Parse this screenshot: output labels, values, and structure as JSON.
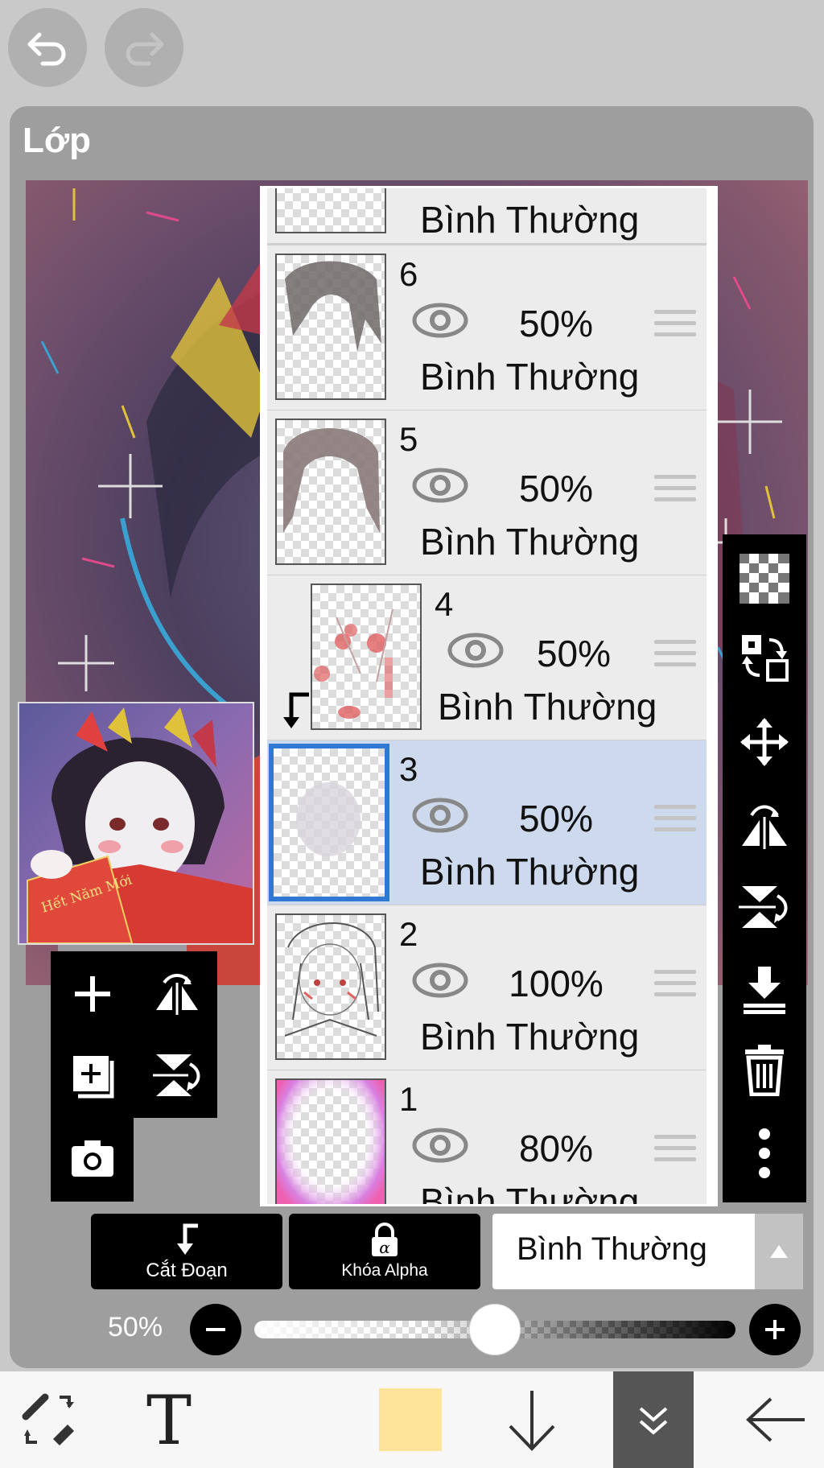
{
  "header": {
    "undo_icon": "undo-icon",
    "redo_icon": "redo-icon"
  },
  "panel": {
    "title": "Lớp"
  },
  "thumbnail_artwork": {
    "text": "Hết Năm Mới"
  },
  "layers": [
    {
      "number": "",
      "opacity": "",
      "mode": "Bình Thường",
      "partial": "top"
    },
    {
      "number": "6",
      "opacity": "50%",
      "mode": "Bình Thường"
    },
    {
      "number": "5",
      "opacity": "50%",
      "mode": "Bình Thường"
    },
    {
      "number": "4",
      "opacity": "50%",
      "mode": "Bình Thường",
      "clipped": true
    },
    {
      "number": "3",
      "opacity": "50%",
      "mode": "Bình Thường",
      "selected": true
    },
    {
      "number": "2",
      "opacity": "100%",
      "mode": "Bình Thường"
    },
    {
      "number": "1",
      "opacity": "80%",
      "mode": "Bình Thường",
      "partial": "bottom"
    }
  ],
  "right_tools": [
    "checker-icon",
    "swap-layer-icon",
    "move-icon",
    "flip-horizontal-icon",
    "flip-vertical-icon",
    "merge-down-icon",
    "trash-icon",
    "more-icon"
  ],
  "left_tools": [
    "add-layer-icon",
    "flip-horizontal-icon",
    "add-copy-icon",
    "flip-vertical-icon",
    "camera-icon"
  ],
  "controls": {
    "clip_label": "Cắt Đoạn",
    "alpha_lock_label": "Khóa Alpha",
    "blend_mode": "Bình Thường",
    "opacity_label": "50%",
    "opacity_value": 0.5
  },
  "bottom_bar": {
    "color_swatch": "#fde49a",
    "items": [
      "brush-eraser-icon",
      "text-icon",
      "color-swatch",
      "down-arrow-icon",
      "collapse-icon",
      "back-arrow-icon"
    ]
  }
}
